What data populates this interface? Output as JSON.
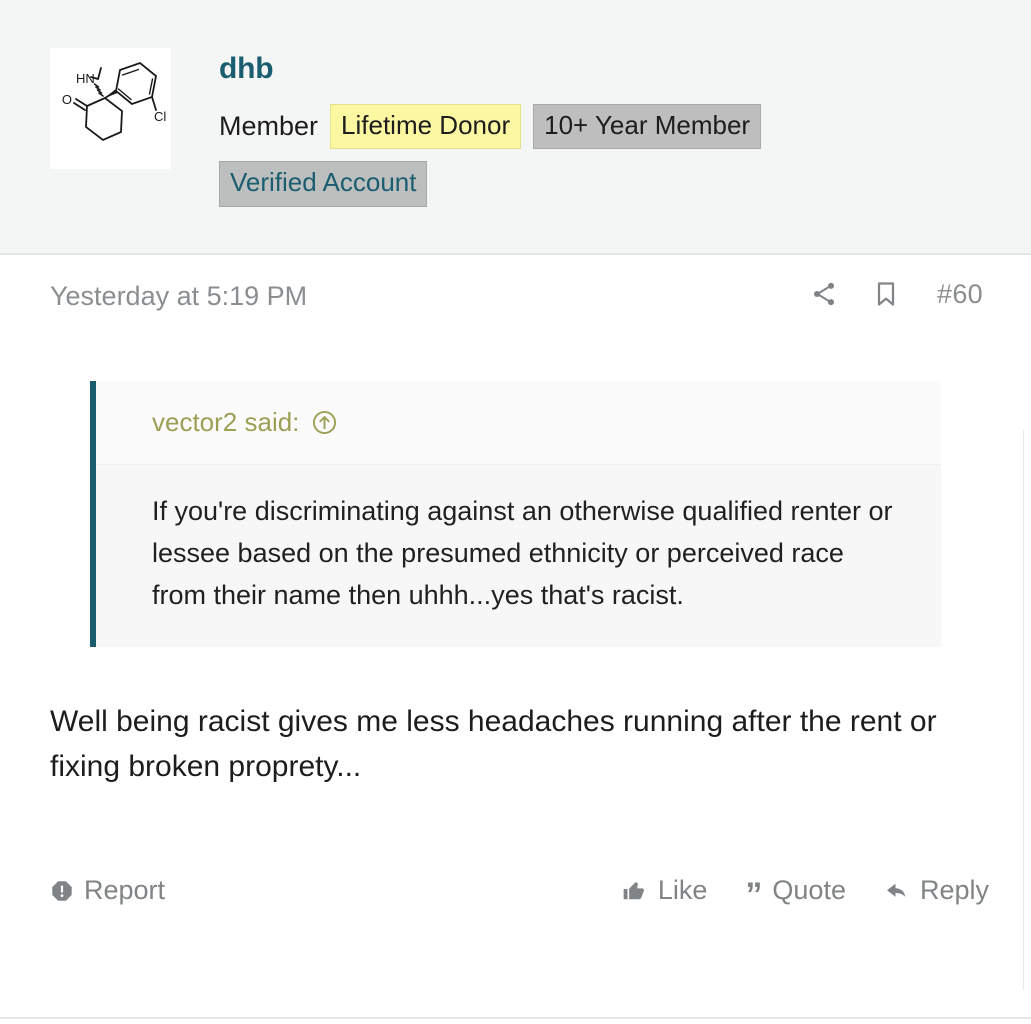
{
  "post": {
    "author": {
      "username": "dhb",
      "title": "Member",
      "avatar_alt": "ketamine-structure",
      "badges": [
        {
          "label": "Lifetime Donor",
          "style": "donor"
        },
        {
          "label": "10+ Year Member",
          "style": "year"
        },
        {
          "label": "Verified Account",
          "style": "verified"
        }
      ]
    },
    "meta": {
      "date": "Yesterday at 5:19 PM",
      "post_number": "#60",
      "share_icon": "share-icon",
      "bookmark_icon": "bookmark-icon"
    },
    "quote": {
      "attribution": "vector2 said:",
      "jump_icon": "circled-up-arrow-icon",
      "text": "If you're discriminating against an otherwise qualified renter or lessee based on the presumed ethnicity or perceived race from their name then uhhh...yes that's racist."
    },
    "body": "Well being racist gives me less headaches running after the rent or fixing broken proprety...",
    "actions": {
      "report": {
        "label": "Report",
        "icon": "report-octagon-icon"
      },
      "like": {
        "label": "Like",
        "icon": "thumbs-up-icon"
      },
      "quote": {
        "label": "Quote",
        "icon": "quote-marks-icon"
      },
      "reply": {
        "label": "Reply",
        "icon": "reply-arrow-icon"
      }
    }
  },
  "colors": {
    "username": "#1b5d70",
    "quote_border": "#1a5b6c",
    "quote_attribution": "#9ba055",
    "donor_badge_bg": "#fcf8a2",
    "gray_badge_bg": "#bebebe",
    "muted_text": "#8b8e90",
    "header_bg": "#f4f5f5"
  }
}
